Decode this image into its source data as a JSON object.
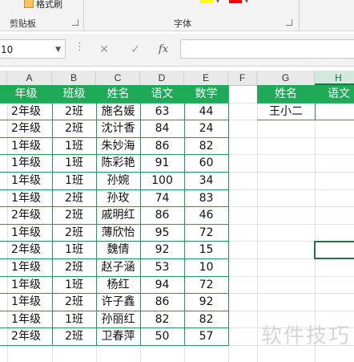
{
  "ribbon": {
    "format_painter": "格式刷",
    "clipboard_label": "剪贴板",
    "font_label": "字体"
  },
  "formula_bar": {
    "name_box": "10",
    "fx": "fx",
    "formula": ""
  },
  "columns": [
    "A",
    "B",
    "C",
    "D",
    "E",
    "F",
    "G",
    "H"
  ],
  "table": {
    "headers": [
      "年级",
      "班级",
      "姓名",
      "语文",
      "数学"
    ],
    "rows": [
      [
        "2年级",
        "2班",
        "施名媛",
        "63",
        "44"
      ],
      [
        "2年级",
        "2班",
        "沈计香",
        "84",
        "24"
      ],
      [
        "1年级",
        "1班",
        "朱妙海",
        "86",
        "82"
      ],
      [
        "1年级",
        "1班",
        "陈彩艳",
        "91",
        "60"
      ],
      [
        "1年级",
        "1班",
        "孙婉",
        "100",
        "34"
      ],
      [
        "1年级",
        "2班",
        "孙玫",
        "74",
        "83"
      ],
      [
        "2年级",
        "2班",
        "戚明红",
        "86",
        "46"
      ],
      [
        "1年级",
        "2班",
        "薄欣怡",
        "95",
        "72"
      ],
      [
        "2年级",
        "1班",
        "魏倩",
        "92",
        "15"
      ],
      [
        "1年级",
        "2班",
        "赵子涵",
        "53",
        "10"
      ],
      [
        "1年级",
        "1班",
        "杨红",
        "94",
        "72"
      ],
      [
        "1年级",
        "2班",
        "许子鑫",
        "86",
        "92"
      ],
      [
        "1年级",
        "1班",
        "孙丽红",
        "82",
        "82"
      ],
      [
        "2年级",
        "2班",
        "卫春萍",
        "50",
        "57"
      ]
    ]
  },
  "lookup": {
    "headers": [
      "姓名",
      "语文"
    ],
    "values": [
      "王小二",
      ""
    ]
  },
  "watermark": "软件技巧",
  "colors": {
    "header_green": "#1faa57",
    "border_green": "#1f9d55",
    "selection": "#217346"
  }
}
